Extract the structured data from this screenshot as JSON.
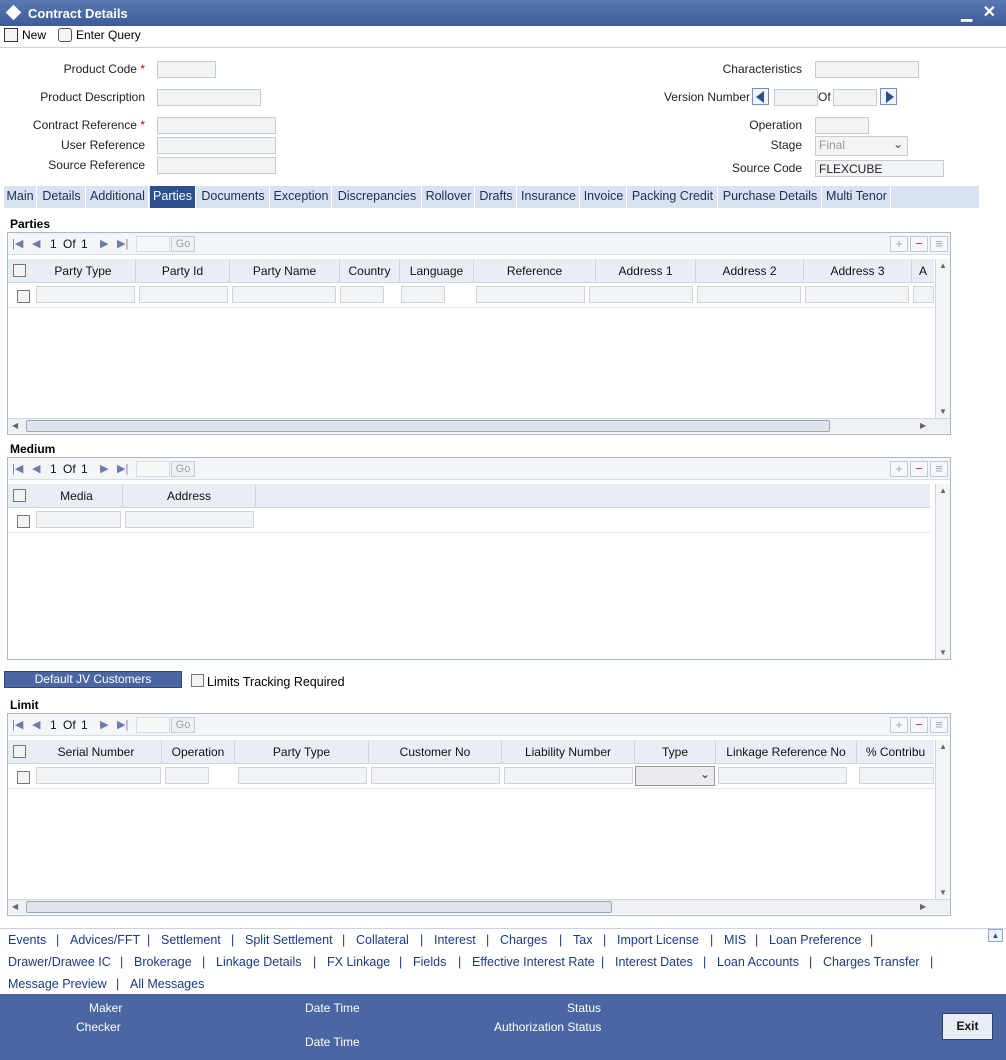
{
  "window": {
    "title": "Contract Details"
  },
  "toolbar": {
    "new_label": "New",
    "enter_query_label": "Enter Query"
  },
  "form": {
    "product_code_label": "Product Code",
    "product_description_label": "Product Description",
    "contract_reference_label": "Contract Reference",
    "user_reference_label": "User Reference",
    "source_reference_label": "Source Reference",
    "characteristics_label": "Characteristics",
    "version_number_label": "Version Number",
    "of_label": "Of",
    "operation_label": "Operation",
    "stage_label": "Stage",
    "stage_value": "Final",
    "source_code_label": "Source Code",
    "source_code_value": "FLEXCUBE",
    "required_mark": "*"
  },
  "tabs": [
    "Main",
    "Details",
    "Additional",
    "Parties",
    "Documents",
    "Exception",
    "Discrepancies",
    "Rollover",
    "Drafts",
    "Insurance",
    "Invoice",
    "Packing Credit",
    "Purchase Details",
    "Multi Tenor"
  ],
  "active_tab": "Parties",
  "parties": {
    "title": "Parties",
    "page": "1",
    "of_label": "Of",
    "total": "1",
    "go_label": "Go",
    "columns": [
      "Party Type",
      "Party Id",
      "Party Name",
      "Country",
      "Language",
      "Reference",
      "Address 1",
      "Address 2",
      "Address 3",
      "A"
    ]
  },
  "medium": {
    "title": "Medium",
    "page": "1",
    "of_label": "Of",
    "total": "1",
    "go_label": "Go",
    "columns": [
      "Media",
      "Address"
    ]
  },
  "jv": {
    "default_jv_label": "Default JV Customers",
    "limits_tracking_label": "Limits Tracking Required"
  },
  "limit": {
    "title": "Limit",
    "page": "1",
    "of_label": "Of",
    "total": "1",
    "go_label": "Go",
    "columns": [
      "Serial Number",
      "Operation",
      "Party Type",
      "Customer No",
      "Liability Number",
      "Type",
      "Linkage Reference No",
      "% Contribu"
    ]
  },
  "links": {
    "row1": [
      "Events",
      "Advices/FFT",
      "Settlement",
      "Split Settlement",
      "Collateral",
      "Interest",
      "Charges",
      "Tax",
      "Import License",
      "MIS",
      "Loan Preference"
    ],
    "row2": [
      "Drawer/Drawee IC",
      "Brokerage",
      "Linkage Details",
      "FX Linkage",
      "Fields",
      "Effective Interest Rate",
      "Interest Dates",
      "Loan Accounts",
      "Charges Transfer"
    ],
    "row3": [
      "Message Preview",
      "All Messages"
    ],
    "separator": "|"
  },
  "footer": {
    "maker_label": "Maker",
    "checker_label": "Checker",
    "datetime_label": "Date Time",
    "status_label": "Status",
    "auth_status_label": "Authorization Status",
    "exit_label": "Exit"
  },
  "colors": {
    "accent": "#4a67a3",
    "active_tab": "#2c4f8f",
    "link": "#1a3a8a",
    "required": "#dd0000"
  }
}
